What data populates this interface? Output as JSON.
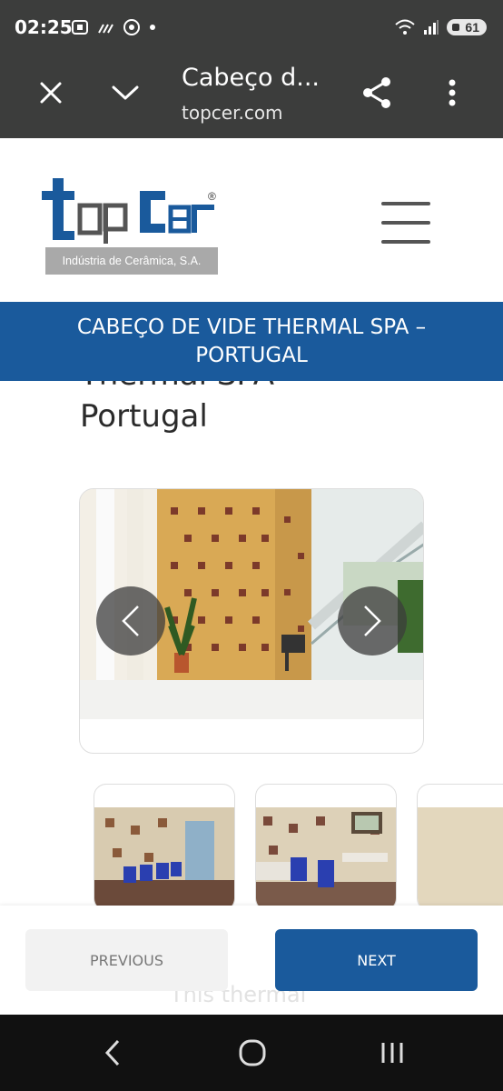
{
  "status_bar": {
    "time": "02:25",
    "battery": "61",
    "colors": {
      "background": "#3c3d3c"
    }
  },
  "browser": {
    "page_title": "Cabeço d...",
    "url": "topcer.com",
    "icons": [
      "close-icon",
      "chevron-down-icon",
      "share-icon",
      "more-vert-icon"
    ]
  },
  "site": {
    "logo_text": "topCer",
    "logo_subtitle": "Indústria de Cerâmica, S.A.",
    "logo_mark": "®",
    "banner_title": "CABEÇO DE VIDE THERMAL SPA – PORTUGAL",
    "heading_line1": "Thermal SPA –",
    "heading_line2": "Portugal",
    "colors": {
      "brand_blue": "#1a5a9c",
      "logo_grey": "#a9a9a9"
    }
  },
  "carousel": {
    "prev_icon": "chevron-left-icon",
    "next_icon": "chevron-right-icon"
  },
  "actions": {
    "previous_label": "PREVIOUS",
    "next_label": "NEXT",
    "faded_text": "This thermal"
  },
  "android_nav": [
    "back-icon",
    "home-icon",
    "recents-icon"
  ]
}
